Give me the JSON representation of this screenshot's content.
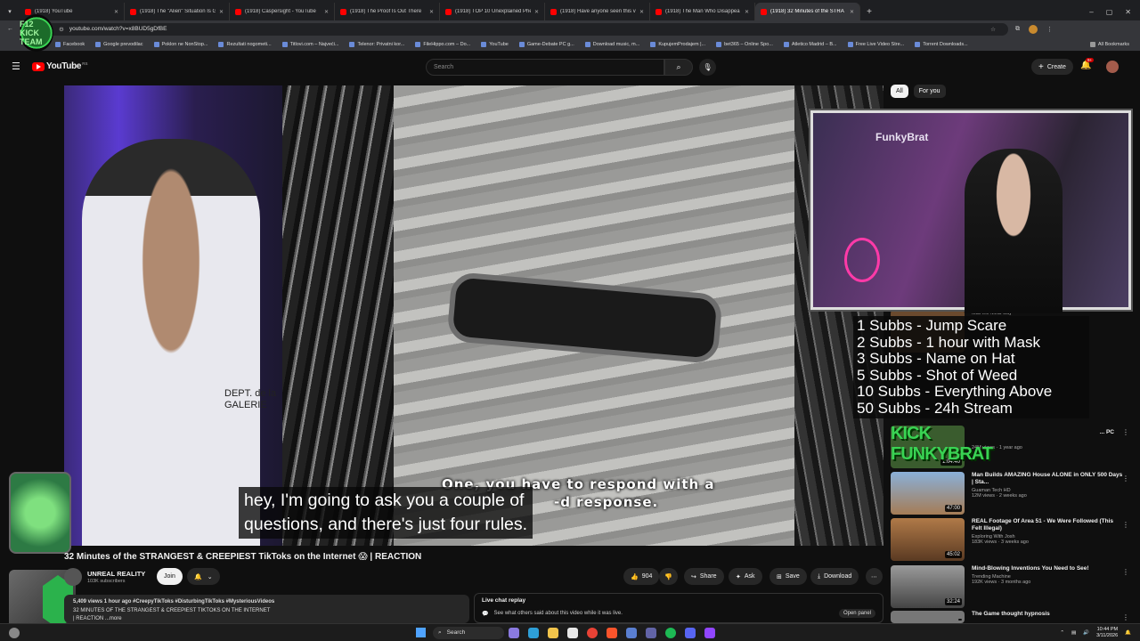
{
  "browser": {
    "tabs": [
      {
        "title": "(1918) YouTube"
      },
      {
        "title": "(1918) The \"Alien\" Situation Is G"
      },
      {
        "title": "(1918) Caspersight - YouTube"
      },
      {
        "title": "(1918) The Proof Is Out There"
      },
      {
        "title": "(1918) TOP 10 Unexplained Phe"
      },
      {
        "title": "(1918) Have anyone seen this v"
      },
      {
        "title": "(1918) The Man Who Disappea"
      },
      {
        "title": "(1918) 32 Minutes of the STRA"
      }
    ],
    "url": "youtube.com/watch?v=x8BUD5gDfBE",
    "bookmarks": [
      "Facebook",
      "Google prevodilac",
      "Poklon ne NonStop...",
      "Rezultati nogometi...",
      "Titlovi.com – Najveći...",
      "Telenor: Privatni kor...",
      "FileHippo.com – Do...",
      "YouTube",
      "Game-Debate PC g...",
      "Download music, m...",
      "KupujemProdajem |...",
      "bet365 – Online Spo...",
      "Atletico Madrid – B...",
      "Free Live Video Stre...",
      "Torrent Downloads..."
    ],
    "all_bookmarks": "All Bookmarks"
  },
  "youtube": {
    "logo": "YouTube",
    "logo_sup": "RS",
    "search_placeholder": "Search",
    "create_label": "Create",
    "notif_count": "9+",
    "chips": [
      "All",
      "For you"
    ]
  },
  "video": {
    "burned_sub_line1": "One, you have to respond with a",
    "burned_sub_line2": "-d response.",
    "caption_line1": "hey, I'm going to ask you a couple of",
    "caption_line2": "questions, and there's just four rules.",
    "left_shirt_text": "DEPT. de la GALERIE"
  },
  "overlay": {
    "f12_logo": "F12 KICK TEAM",
    "webcam_sign": "FunkyBrat",
    "subs_rules": [
      "1 Subbs - Jump Scare",
      "2 Subbs - 1 hour with Mask",
      "3 Subbs - Name on Hat",
      "5 Subbs - Shot of Weed",
      "10 Subbs - Everything Above",
      "50 Subbs - 24h Stream"
    ],
    "kick_text": "KICK FUNKYBRAT"
  },
  "watch": {
    "title": "32 Minutes of the STRANGEST & CREEPIEST TikToks on the Internet 😱 | REACTION",
    "channel": "UNREAL REALITY",
    "subscribers": "103K subscribers",
    "join_label": "Join",
    "likes": "904",
    "share_label": "Share",
    "ask_label": "Ask",
    "save_label": "Save",
    "download_label": "Download",
    "desc_meta": "5,409 views  1 hour ago  #CreepyTikToks #DisturbingTikToks #MysteriousVideos",
    "desc_line": "32 MINUTES OF THE STRANGEST & CREEPIEST TIKTOKS ON THE INTERNET",
    "desc_more": "| REACTION  ...more",
    "live_chat_title": "Live chat replay",
    "live_chat_text": "See what others said about this video while it was live.",
    "open_panel": "Open panel"
  },
  "recommendations": [
    {
      "title": "Max the Meat Guy",
      "channel": "",
      "meta": "",
      "duration": ""
    },
    {
      "title": "... PC",
      "channel": "",
      "meta": "24M views · 1 year ago",
      "duration": "1:04:40"
    },
    {
      "title": "Man Builds AMAZING House ALONE in ONLY 500 Days | Sta...",
      "channel": "Guaman Tech HD",
      "meta": "12M views · 2 weeks ago",
      "duration": "47:00"
    },
    {
      "title": "REAL Footage Of Area 51 - We Were Followed (This Felt Illegal)",
      "channel": "Exploring With Josh",
      "meta": "183K views · 3 weeks ago",
      "duration": "45:02"
    },
    {
      "title": "Mind-Blowing Inventions You Need to See!",
      "channel": "Trending Machine",
      "meta": "192K views · 3 months ago",
      "duration": "32:24"
    },
    {
      "title": "The Game thought hypnosis",
      "channel": "",
      "meta": "",
      "duration": ""
    }
  ],
  "taskbar": {
    "search_label": "Search",
    "time": "10:44 PM",
    "date": "3/11/2026"
  }
}
